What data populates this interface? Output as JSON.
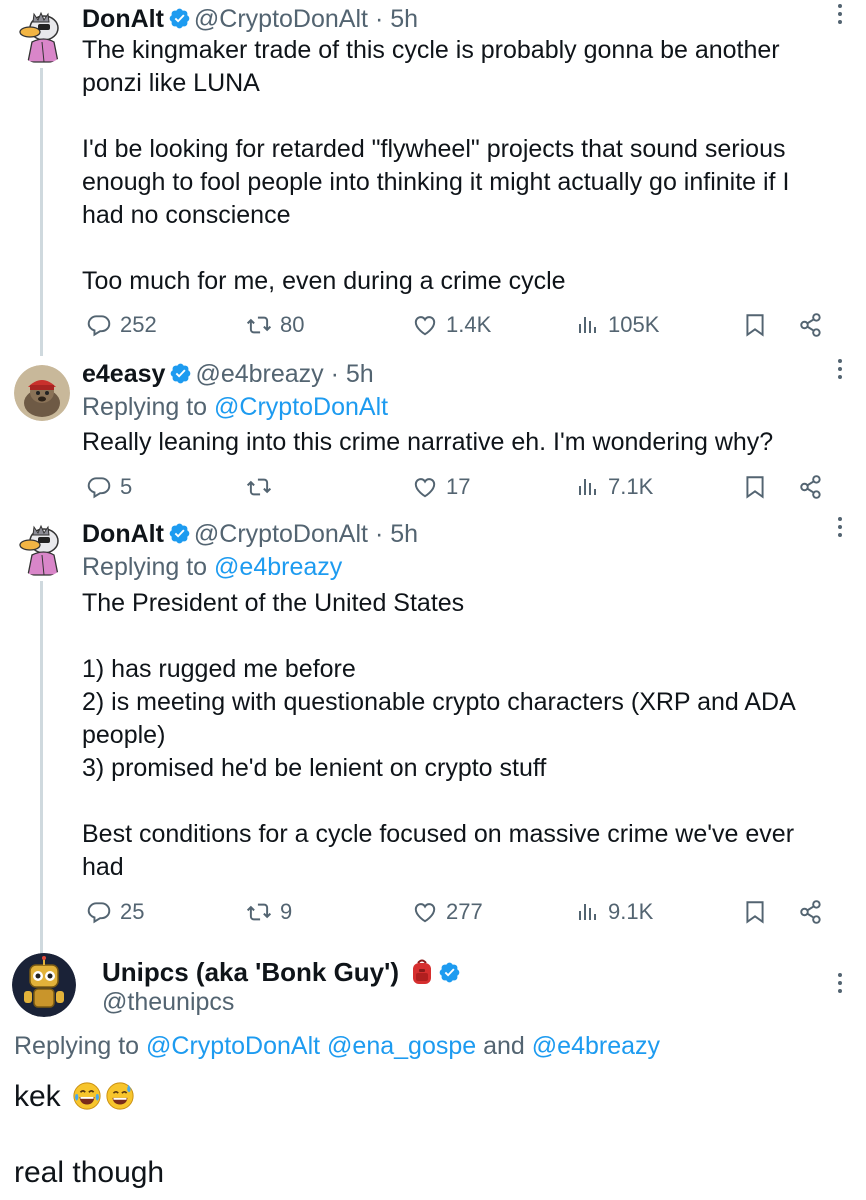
{
  "colors": {
    "text": "#0f1419",
    "secondary": "#536471",
    "link": "#1d9bf0",
    "verified": "#1d9bf0",
    "thread_line": "#cfd9de"
  },
  "tweets": [
    {
      "name": "DonAlt",
      "handle": "@CryptoDonAlt",
      "time": "· 5h",
      "lines": [
        "The kingmaker trade of this cycle is probably gonna be another",
        "ponzi like LUNA",
        "I'd be looking for retarded \"flywheel\" projects that sound serious",
        "enough to fool people into thinking it might actually go infinite if I",
        "had no conscience",
        "Too much for me, even during a crime cycle"
      ],
      "replies": "252",
      "retweets": "80",
      "likes": "1.4K",
      "views": "105K"
    },
    {
      "name": "e4easy",
      "handle": "@e4breazy",
      "time": "· 5h",
      "replying_prefix": "Replying to",
      "replying_to": "@CryptoDonAlt",
      "lines": [
        "Really leaning into this crime narrative eh. I'm wondering why?"
      ],
      "replies": "5",
      "retweets": "",
      "likes": "17",
      "views": "7.1K"
    },
    {
      "name": "DonAlt",
      "handle": "@CryptoDonAlt",
      "time": "· 5h",
      "replying_prefix": "Replying to",
      "replying_to": "@e4breazy",
      "lines": [
        "The President of the United States",
        "1) has rugged me before",
        "2) is meeting with questionable crypto characters (XRP and ADA",
        "people)",
        "3) promised he'd be lenient on crypto stuff",
        "Best conditions for a cycle focused on massive crime we've ever",
        "had"
      ],
      "replies": "25",
      "retweets": "9",
      "likes": "277",
      "views": "9.1K"
    }
  ],
  "main_tweet": {
    "name": "Unipcs (aka 'Bonk Guy')",
    "handle": "@theunipcs",
    "replying_prefix": "Replying to",
    "replying_to_1": "@CryptoDonAlt",
    "replying_to_2": "@ena_gospe",
    "replying_and": "and",
    "replying_to_3": "@e4breazy",
    "text_1": "kek",
    "text_2": "real though"
  },
  "icons": [
    "reply-icon",
    "retweet-icon",
    "like-icon",
    "views-icon",
    "bookmark-icon",
    "share-icon",
    "verified-badge-icon",
    "more-icon",
    "backpack-emoji-icon",
    "laughing-tears-emoji-icon",
    "sweat-smile-emoji-icon"
  ]
}
